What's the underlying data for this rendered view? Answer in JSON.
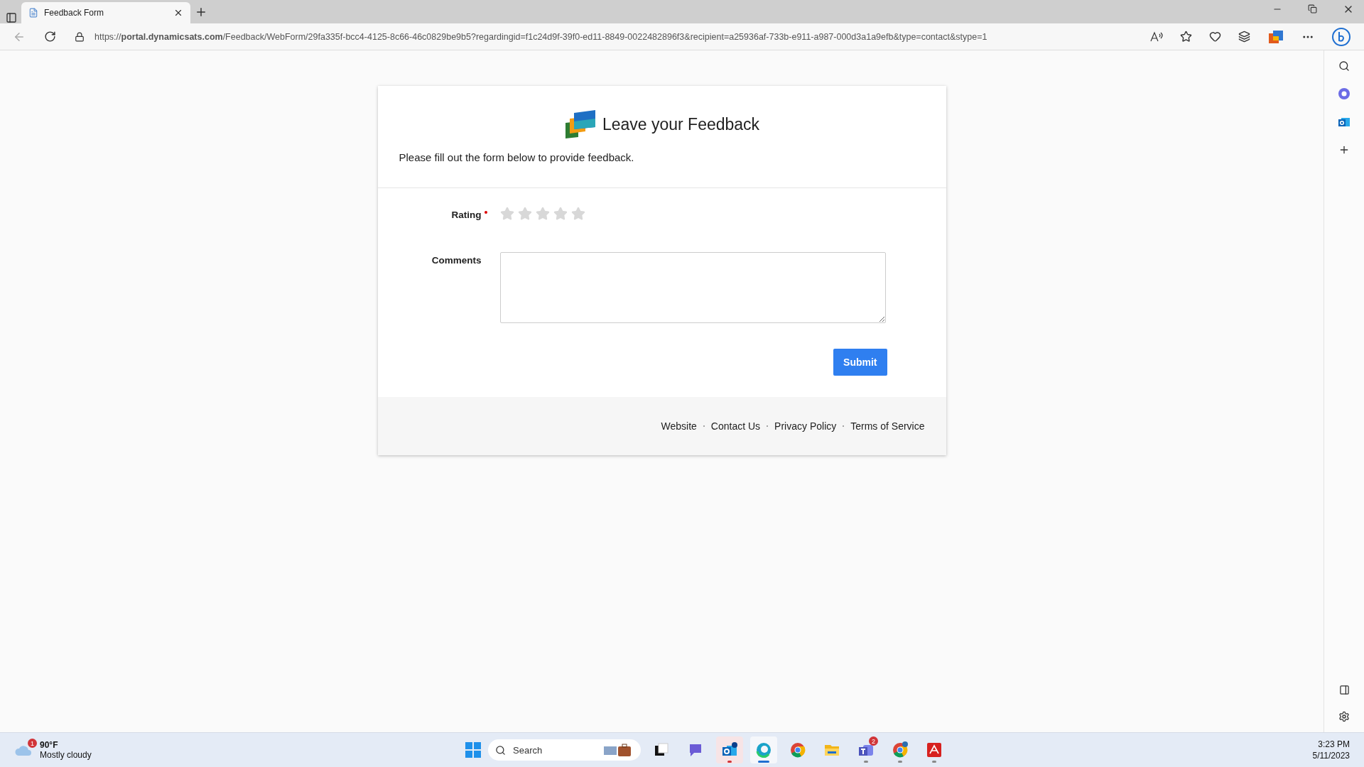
{
  "browser": {
    "tabs": [
      {
        "title": "Feedback Form",
        "selected": true
      }
    ],
    "address": "https://**portal.dynamicsats.com**/Feedback/WebForm/29fa335f-bcc4-4125-8c66-46c0829be9b5?regardingid=f1c24d9f-39f0-ed11-8849-0022482896f3&recipient=a25936af-733b-e911-a987-000d3a1a9efb&type=contact&stype=1"
  },
  "form": {
    "title": "Leave your Feedback",
    "intro": "Please fill out the form below to provide feedback.",
    "fields": [
      {
        "kind": "rating",
        "label": "Rating",
        "required": true,
        "stars": 0
      },
      {
        "kind": "textarea",
        "label": "Comments",
        "required": false
      }
    ],
    "submit": "Submit",
    "footer_links": [
      "Website",
      "Contact Us",
      "Privacy Policy",
      "Terms of Service"
    ]
  },
  "taskbar": {
    "weather": {
      "temperature": "90°F",
      "condition": "Mostly cloudy",
      "badge": "1"
    },
    "search": {
      "placeholder": "Search"
    },
    "apps": [
      {
        "kind": "taskview",
        "running": false,
        "selected": false
      },
      {
        "kind": "chat",
        "running": false,
        "selected": false
      },
      {
        "kind": "outlook",
        "running": true,
        "selected": false,
        "alert": true
      },
      {
        "kind": "edge",
        "running": true,
        "selected": true
      },
      {
        "kind": "chrome",
        "running": false,
        "selected": false
      },
      {
        "kind": "files",
        "running": false,
        "selected": false
      },
      {
        "kind": "teams",
        "running": true,
        "selected": false,
        "badge": "2"
      },
      {
        "kind": "chrome-dev",
        "running": true,
        "selected": false
      },
      {
        "kind": "acrobat",
        "running": true,
        "selected": false
      }
    ],
    "time": "3:23 PM",
    "date": "5/11/2023"
  }
}
